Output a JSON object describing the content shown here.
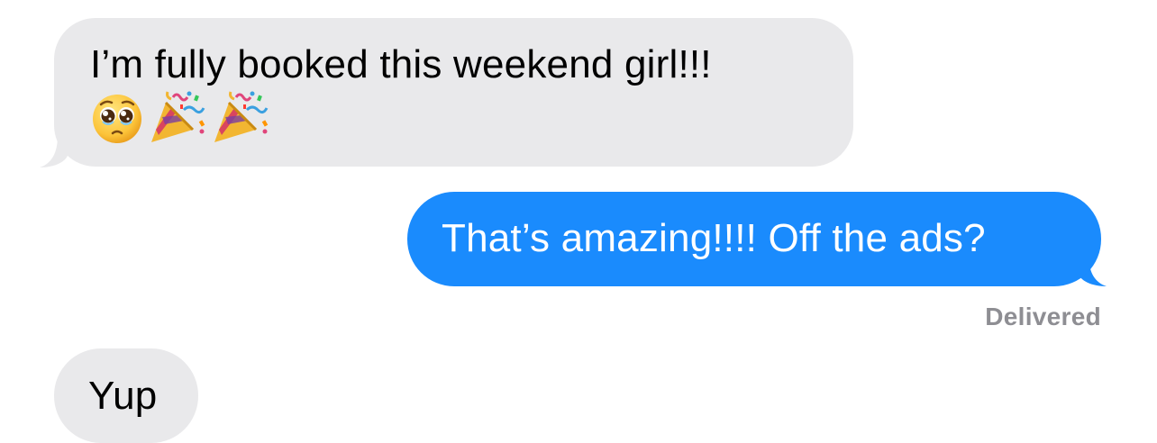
{
  "messages": [
    {
      "direction": "incoming",
      "text_line1": "I’m fully booked this weekend girl!!!",
      "emojis": [
        "pleading-face-icon",
        "party-popper-icon",
        "party-popper-icon"
      ]
    },
    {
      "direction": "outgoing",
      "text": "That’s amazing!!!! Off the ads?",
      "status": "Delivered"
    },
    {
      "direction": "incoming",
      "text": "Yup"
    }
  ],
  "colors": {
    "incoming_bubble": "#e9e9eb",
    "outgoing_bubble": "#1a8bfd",
    "status_text": "#8e8e93"
  }
}
